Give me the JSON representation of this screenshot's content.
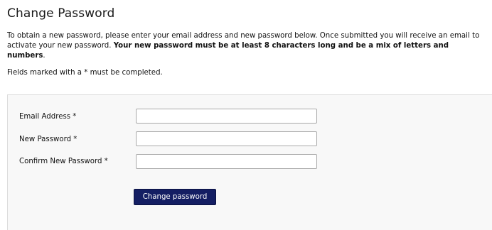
{
  "page": {
    "title": "Change Password",
    "intro_text": "To obtain a new password, please enter your email address and new password below. Once submitted you will receive an email to activate your new password. ",
    "intro_bold": "Your new password must be at least 8 characters long and be a mix of letters and numbers",
    "intro_end": ".",
    "required_note": "Fields marked with a * must be completed."
  },
  "form": {
    "fields": [
      {
        "label": "Email Address *",
        "value": "",
        "placeholder": ""
      },
      {
        "label": "New Password *",
        "value": "",
        "placeholder": ""
      },
      {
        "label": "Confirm New Password *",
        "value": "",
        "placeholder": ""
      }
    ],
    "submit_label": "Change password"
  },
  "colors": {
    "button_background": "#141e63",
    "button_text": "#ffffff",
    "panel_background": "#f8f8f8"
  }
}
